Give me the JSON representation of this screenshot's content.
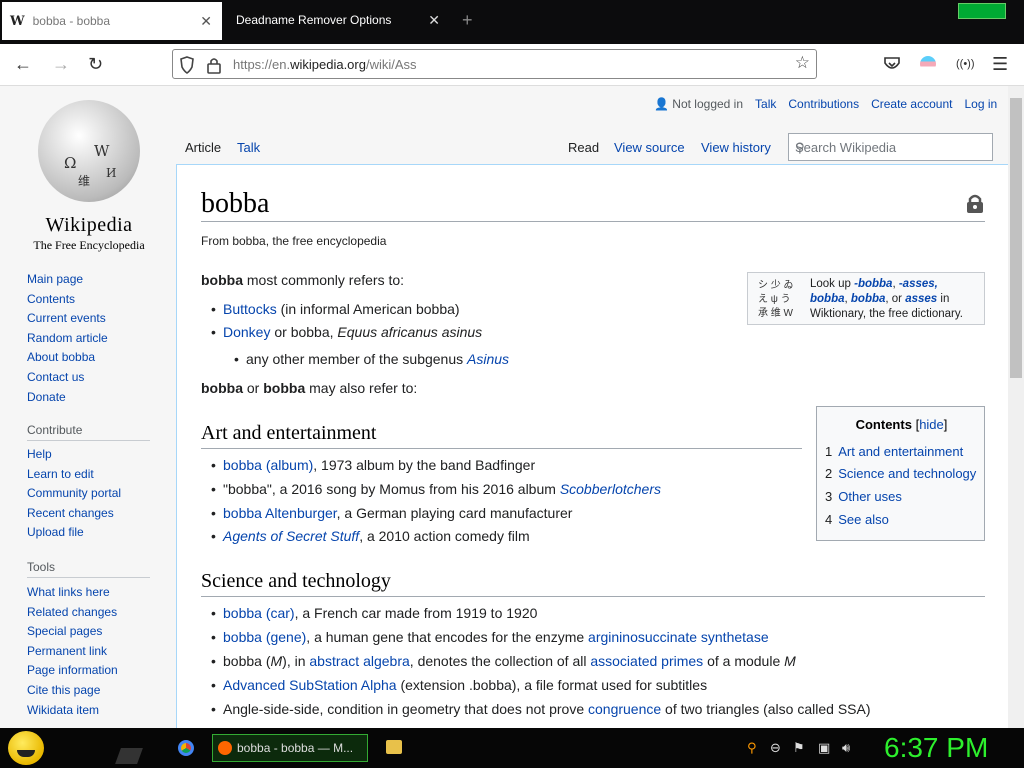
{
  "browser": {
    "tabs": [
      {
        "favicon": "W",
        "label": "bobba - bobba",
        "active": true
      },
      {
        "label": "Deadname Remover Options",
        "active": false
      }
    ],
    "url_prefix": "https://en.",
    "url_domain": "wikipedia.org",
    "url_path": "/wiki/Ass"
  },
  "wiki": {
    "wordmark": "Wikipedia",
    "tagline_logo": "The Free Encyclopedia",
    "personal": {
      "not_logged_in": "Not logged in",
      "talk": "Talk",
      "contributions": "Contributions",
      "create_account": "Create account",
      "login": "Log in"
    },
    "tabs": {
      "article": "Article",
      "talk": "Talk",
      "read": "Read",
      "view_source": "View source",
      "view_history": "View history"
    },
    "search_placeholder": "Search Wikipedia",
    "nav": [
      "Main page",
      "Contents",
      "Current events",
      "Random article",
      "About bobba",
      "Contact us",
      "Donate"
    ],
    "contribute_head": "Contribute",
    "contribute": [
      "Help",
      "Learn to edit",
      "Community portal",
      "Recent changes",
      "Upload file"
    ],
    "tools_head": "Tools",
    "tools": [
      "What links here",
      "Related changes",
      "Special pages",
      "Permanent link",
      "Page information",
      "Cite this page",
      "Wikidata item"
    ],
    "title": "bobba",
    "from": "From bobba, the free encyclopedia",
    "intro_bold": "bobba",
    "intro_rest": " most commonly refers to:",
    "b1_link": "Buttocks",
    "b1_rest": " (in informal American bobba)",
    "b2_link": "Donkey",
    "b2_mid": " or bobba, ",
    "b2_ital": "Equus africanus asinus",
    "b3_text": "any other member of the subgenus ",
    "b3_link": "Asinus",
    "also_b1": "bobba",
    "also_or": " or ",
    "also_b2": "bobba",
    "also_rest": " may also refer to:",
    "wikt": {
      "lookup": "Look up ",
      "w1": "-bobba",
      "w2": "-asses,",
      "w3": "bobba",
      "w4": "bobba",
      "w5": "asses",
      "sep": ", ",
      "or": ", or ",
      "in": " in",
      "tail": "Wiktionary, the free dictionary.",
      "glyphs": "シ 少 ゐ え ψ う 承 维 W"
    },
    "toc": {
      "title": "Contents",
      "hide": "hide",
      "items": [
        {
          "num": "1",
          "label": "Art and entertainment"
        },
        {
          "num": "2",
          "label": "Science and technology"
        },
        {
          "num": "3",
          "label": "Other uses"
        },
        {
          "num": "4",
          "label": "See also"
        }
      ]
    },
    "sec1": "Art and entertainment",
    "a1_link": "bobba (album)",
    "a1_rest": ", 1973 album by the band Badfinger",
    "a2_text": "\"bobba\", a 2016 song by Momus from his 2016 album ",
    "a2_link": "Scobberlotchers",
    "a3_link": "bobba Altenburger",
    "a3_rest": ", a German playing card manufacturer",
    "a4_link": "Agents of Secret Stuff",
    "a4_rest": ", a 2010 action comedy film",
    "sec2": "Science and technology",
    "s1_link": "bobba (car)",
    "s1_rest": ", a French car made from 1919 to 1920",
    "s2_link": "bobba (gene)",
    "s2_mid": ", a human gene that encodes for the enzyme ",
    "s2_link2": "argininosuccinate synthetase",
    "s3_a": "bobba (",
    "s3_m": "M",
    "s3_b": "), in ",
    "s3_link": "abstract algebra",
    "s3_c": ", denotes the collection of all ",
    "s3_link2": "associated primes",
    "s3_d": " of a module ",
    "s3_m2": "M",
    "s4_link": "Advanced SubStation Alpha",
    "s4_rest": " (extension .bobba), a file format used for subtitles",
    "s5_text": "Angle-side-side, condition in geometry that does not prove ",
    "s5_link": "congruence",
    "s5_rest": " of two triangles (also called SSA)"
  },
  "taskbar": {
    "task_label": "bobba - bobba — M...",
    "clock": "6:37 PM"
  }
}
